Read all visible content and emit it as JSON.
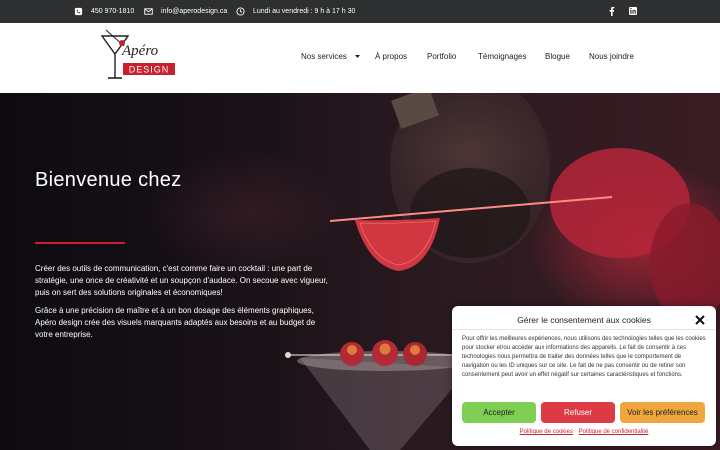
{
  "topbar": {
    "phone": "450 970-1810",
    "email": "info@aperodesign.ca",
    "hours": "Lundi au vendredi : 9 h à 17 h 30",
    "icons": [
      "phone-icon",
      "email-icon",
      "clock-icon",
      "facebook-icon",
      "linkedin-icon"
    ]
  },
  "header": {
    "logo": {
      "script": "Apéro",
      "banner": "DESIGN"
    },
    "nav": [
      {
        "label": "Nos services",
        "has_dropdown": true
      },
      {
        "label": "À propos"
      },
      {
        "label": "Portfolio"
      },
      {
        "label": "Témoignages"
      },
      {
        "label": "Blogue"
      },
      {
        "label": "Nous joindre"
      }
    ]
  },
  "hero": {
    "title": "Bienvenue chez",
    "paragraph1": "Créer des outils de communication, c'est comme faire un cocktail : une part de stratégie, une once de créativité et un soupçon d'audace. On secoue avec vigueur, puis on sert des solutions originales et économiques!",
    "paragraph2": "Grâce à une précision de maître et à un bon dosage des éléments graphiques, Apéro design crée des visuels marquants adaptés aux besoins et au budget de votre entreprise."
  },
  "cookie": {
    "title": "Gérer le consentement aux cookies",
    "body": "Pour offrir les meilleures expériences, nous utilisons des technologies telles que les cookies pour stocker et/ou accéder aux informations des appareils. Le fait de consentir à ces technologies nous permettra de traiter des données telles que le comportement de navigation ou les ID uniques sur ce site. Le fait de ne pas consentir ou de retirer son consentement peut avoir un effet négatif sur certaines caractéristiques et fonctions.",
    "accept": "Accepter",
    "refuse": "Refuser",
    "prefs": "Voir les préférences",
    "link1": "Politique de cookies",
    "link2": "Politique de confidentialité"
  },
  "colors": {
    "accent": "#c8202f",
    "topbar_bg": "#2d2f30",
    "accept": "#7fcf55",
    "refuse": "#dc3a45",
    "prefs": "#f0a63e"
  }
}
